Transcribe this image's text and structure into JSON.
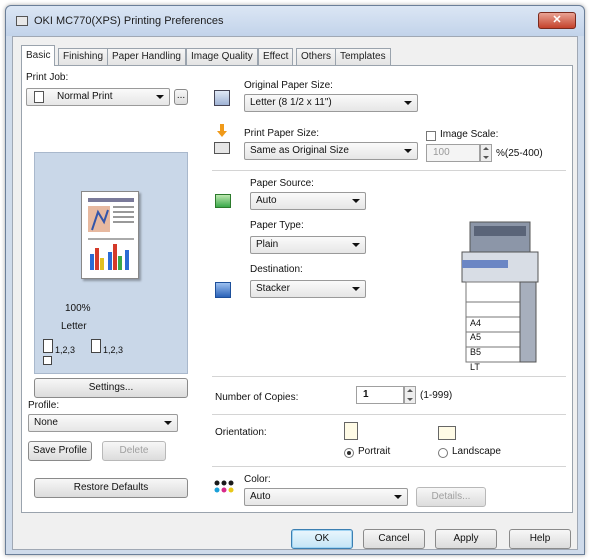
{
  "window": {
    "title": "OKI MC770(XPS) Printing Preferences",
    "close_glyph": "✕"
  },
  "tabs": [
    {
      "label": "Basic",
      "active": true
    },
    {
      "label": "Finishing"
    },
    {
      "label": "Paper Handling"
    },
    {
      "label": "Image Quality"
    },
    {
      "label": "Effect"
    },
    {
      "label": "Others"
    },
    {
      "label": "Templates"
    }
  ],
  "left": {
    "print_job_label": "Print Job:",
    "print_job_value": "Normal Print",
    "more_button": "...",
    "preview": {
      "zoom": "100%",
      "paper": "Letter",
      "collate_label_1": "1,2,3",
      "collate_label_2": "1,2,3"
    },
    "settings_button": "Settings...",
    "profile_label": "Profile:",
    "profile_value": "None",
    "save_profile_button": "Save Profile",
    "delete_button": "Delete",
    "restore_defaults_button": "Restore Defaults"
  },
  "paper": {
    "original_size_label": "Original Paper Size:",
    "original_size_value": "Letter (8 1/2 x 11\")",
    "print_size_label": "Print Paper Size:",
    "print_size_value": "Same as Original Size",
    "image_scale_label": "Image Scale:",
    "image_scale_value": "100",
    "image_scale_range": "%(25-400)",
    "source_label": "Paper Source:",
    "source_value": "Auto",
    "type_label": "Paper Type:",
    "type_value": "Plain",
    "destination_label": "Destination:",
    "destination_value": "Stacker",
    "tray_labels": [
      "A4",
      "A5",
      "B5",
      "LT"
    ]
  },
  "copies": {
    "label": "Number of Copies:",
    "value": "1",
    "range": "(1-999)"
  },
  "orientation": {
    "label": "Orientation:",
    "portrait": "Portrait",
    "landscape": "Landscape",
    "selected": "Portrait"
  },
  "color": {
    "label": "Color:",
    "value": "Auto",
    "details_button": "Details..."
  },
  "footer": {
    "ok": "OK",
    "cancel": "Cancel",
    "apply": "Apply",
    "help": "Help"
  },
  "colors": {
    "titlebar": "#c9d9ee",
    "close": "#c4422c",
    "preview_bg": "#c9d7e8",
    "default_button": "#c4e5f6"
  }
}
